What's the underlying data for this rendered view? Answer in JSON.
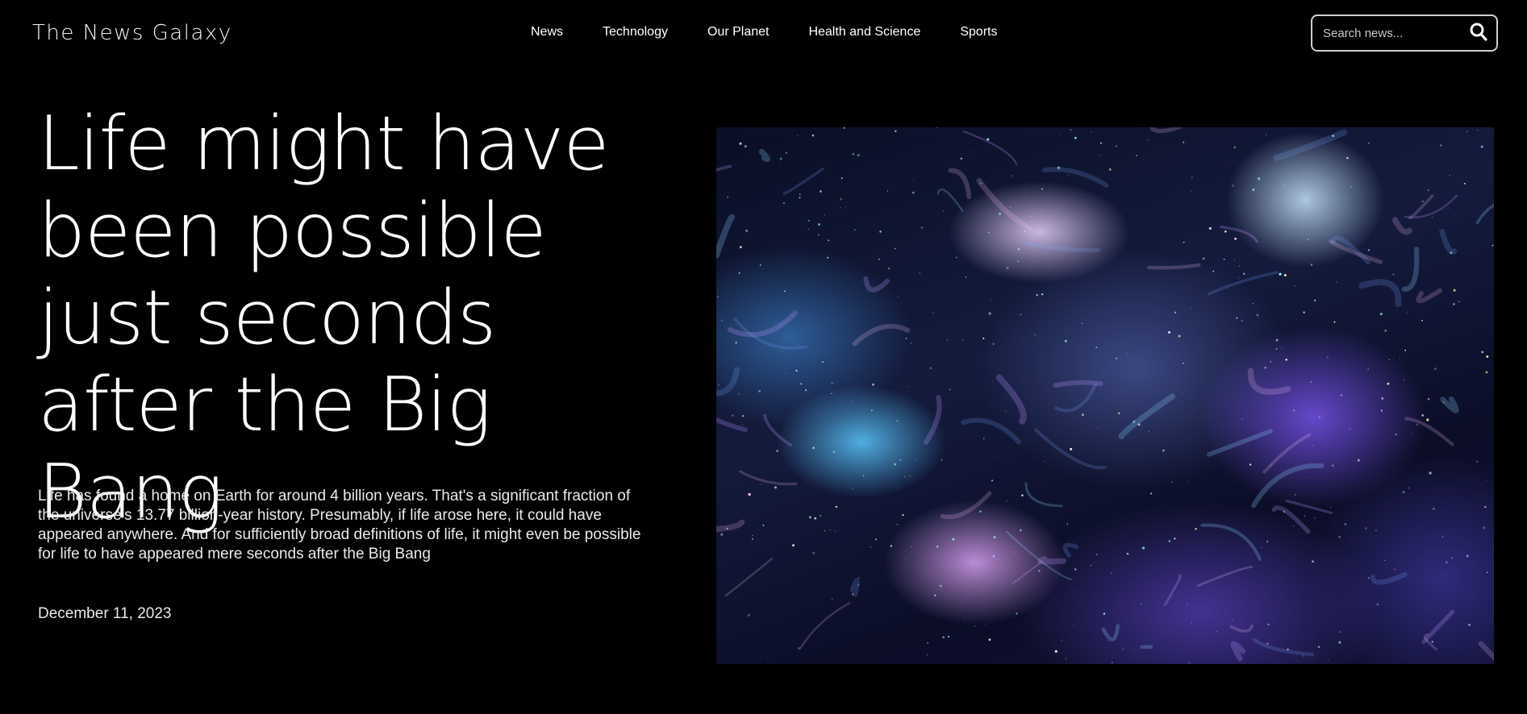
{
  "header": {
    "brand": "The News Galaxy",
    "nav": [
      {
        "label": "News"
      },
      {
        "label": "Technology"
      },
      {
        "label": "Our Planet"
      },
      {
        "label": "Health and Science"
      },
      {
        "label": "Sports"
      }
    ],
    "search": {
      "placeholder": "Search news...",
      "value": "",
      "icon": "search-icon"
    }
  },
  "article": {
    "headline": "Life might have been possible just seconds after the Big Bang",
    "summary": "Life has found a home on Earth for around 4 billion years. That's a significant fraction of the universe's 13.77 billion-year history. Presumably, if life arose here, it could have appeared anywhere. And for sufficiently broad definitions of life, it might even be possible for life to have appeared mere seconds after the Big Bang",
    "date": "December 11, 2023",
    "image": {
      "alt": "Galaxy nebula"
    }
  },
  "colors": {
    "background": "#000000",
    "text": "#ffffff",
    "search_border": "#cfcfcf"
  }
}
